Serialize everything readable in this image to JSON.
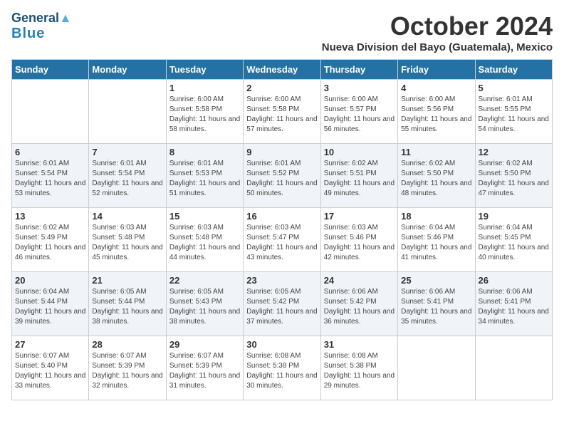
{
  "logo": {
    "line1": "General",
    "line2": "Blue"
  },
  "title": "October 2024",
  "subtitle": "Nueva Division del Bayo (Guatemala), Mexico",
  "days_of_week": [
    "Sunday",
    "Monday",
    "Tuesday",
    "Wednesday",
    "Thursday",
    "Friday",
    "Saturday"
  ],
  "weeks": [
    [
      {
        "day": "",
        "info": ""
      },
      {
        "day": "",
        "info": ""
      },
      {
        "day": "1",
        "info": "Sunrise: 6:00 AM\nSunset: 5:58 PM\nDaylight: 11 hours and 58 minutes."
      },
      {
        "day": "2",
        "info": "Sunrise: 6:00 AM\nSunset: 5:58 PM\nDaylight: 11 hours and 57 minutes."
      },
      {
        "day": "3",
        "info": "Sunrise: 6:00 AM\nSunset: 5:57 PM\nDaylight: 11 hours and 56 minutes."
      },
      {
        "day": "4",
        "info": "Sunrise: 6:00 AM\nSunset: 5:56 PM\nDaylight: 11 hours and 55 minutes."
      },
      {
        "day": "5",
        "info": "Sunrise: 6:01 AM\nSunset: 5:55 PM\nDaylight: 11 hours and 54 minutes."
      }
    ],
    [
      {
        "day": "6",
        "info": "Sunrise: 6:01 AM\nSunset: 5:54 PM\nDaylight: 11 hours and 53 minutes."
      },
      {
        "day": "7",
        "info": "Sunrise: 6:01 AM\nSunset: 5:54 PM\nDaylight: 11 hours and 52 minutes."
      },
      {
        "day": "8",
        "info": "Sunrise: 6:01 AM\nSunset: 5:53 PM\nDaylight: 11 hours and 51 minutes."
      },
      {
        "day": "9",
        "info": "Sunrise: 6:01 AM\nSunset: 5:52 PM\nDaylight: 11 hours and 50 minutes."
      },
      {
        "day": "10",
        "info": "Sunrise: 6:02 AM\nSunset: 5:51 PM\nDaylight: 11 hours and 49 minutes."
      },
      {
        "day": "11",
        "info": "Sunrise: 6:02 AM\nSunset: 5:50 PM\nDaylight: 11 hours and 48 minutes."
      },
      {
        "day": "12",
        "info": "Sunrise: 6:02 AM\nSunset: 5:50 PM\nDaylight: 11 hours and 47 minutes."
      }
    ],
    [
      {
        "day": "13",
        "info": "Sunrise: 6:02 AM\nSunset: 5:49 PM\nDaylight: 11 hours and 46 minutes."
      },
      {
        "day": "14",
        "info": "Sunrise: 6:03 AM\nSunset: 5:48 PM\nDaylight: 11 hours and 45 minutes."
      },
      {
        "day": "15",
        "info": "Sunrise: 6:03 AM\nSunset: 5:48 PM\nDaylight: 11 hours and 44 minutes."
      },
      {
        "day": "16",
        "info": "Sunrise: 6:03 AM\nSunset: 5:47 PM\nDaylight: 11 hours and 43 minutes."
      },
      {
        "day": "17",
        "info": "Sunrise: 6:03 AM\nSunset: 5:46 PM\nDaylight: 11 hours and 42 minutes."
      },
      {
        "day": "18",
        "info": "Sunrise: 6:04 AM\nSunset: 5:46 PM\nDaylight: 11 hours and 41 minutes."
      },
      {
        "day": "19",
        "info": "Sunrise: 6:04 AM\nSunset: 5:45 PM\nDaylight: 11 hours and 40 minutes."
      }
    ],
    [
      {
        "day": "20",
        "info": "Sunrise: 6:04 AM\nSunset: 5:44 PM\nDaylight: 11 hours and 39 minutes."
      },
      {
        "day": "21",
        "info": "Sunrise: 6:05 AM\nSunset: 5:44 PM\nDaylight: 11 hours and 38 minutes."
      },
      {
        "day": "22",
        "info": "Sunrise: 6:05 AM\nSunset: 5:43 PM\nDaylight: 11 hours and 38 minutes."
      },
      {
        "day": "23",
        "info": "Sunrise: 6:05 AM\nSunset: 5:42 PM\nDaylight: 11 hours and 37 minutes."
      },
      {
        "day": "24",
        "info": "Sunrise: 6:06 AM\nSunset: 5:42 PM\nDaylight: 11 hours and 36 minutes."
      },
      {
        "day": "25",
        "info": "Sunrise: 6:06 AM\nSunset: 5:41 PM\nDaylight: 11 hours and 35 minutes."
      },
      {
        "day": "26",
        "info": "Sunrise: 6:06 AM\nSunset: 5:41 PM\nDaylight: 11 hours and 34 minutes."
      }
    ],
    [
      {
        "day": "27",
        "info": "Sunrise: 6:07 AM\nSunset: 5:40 PM\nDaylight: 11 hours and 33 minutes."
      },
      {
        "day": "28",
        "info": "Sunrise: 6:07 AM\nSunset: 5:39 PM\nDaylight: 11 hours and 32 minutes."
      },
      {
        "day": "29",
        "info": "Sunrise: 6:07 AM\nSunset: 5:39 PM\nDaylight: 11 hours and 31 minutes."
      },
      {
        "day": "30",
        "info": "Sunrise: 6:08 AM\nSunset: 5:38 PM\nDaylight: 11 hours and 30 minutes."
      },
      {
        "day": "31",
        "info": "Sunrise: 6:08 AM\nSunset: 5:38 PM\nDaylight: 11 hours and 29 minutes."
      },
      {
        "day": "",
        "info": ""
      },
      {
        "day": "",
        "info": ""
      }
    ]
  ]
}
